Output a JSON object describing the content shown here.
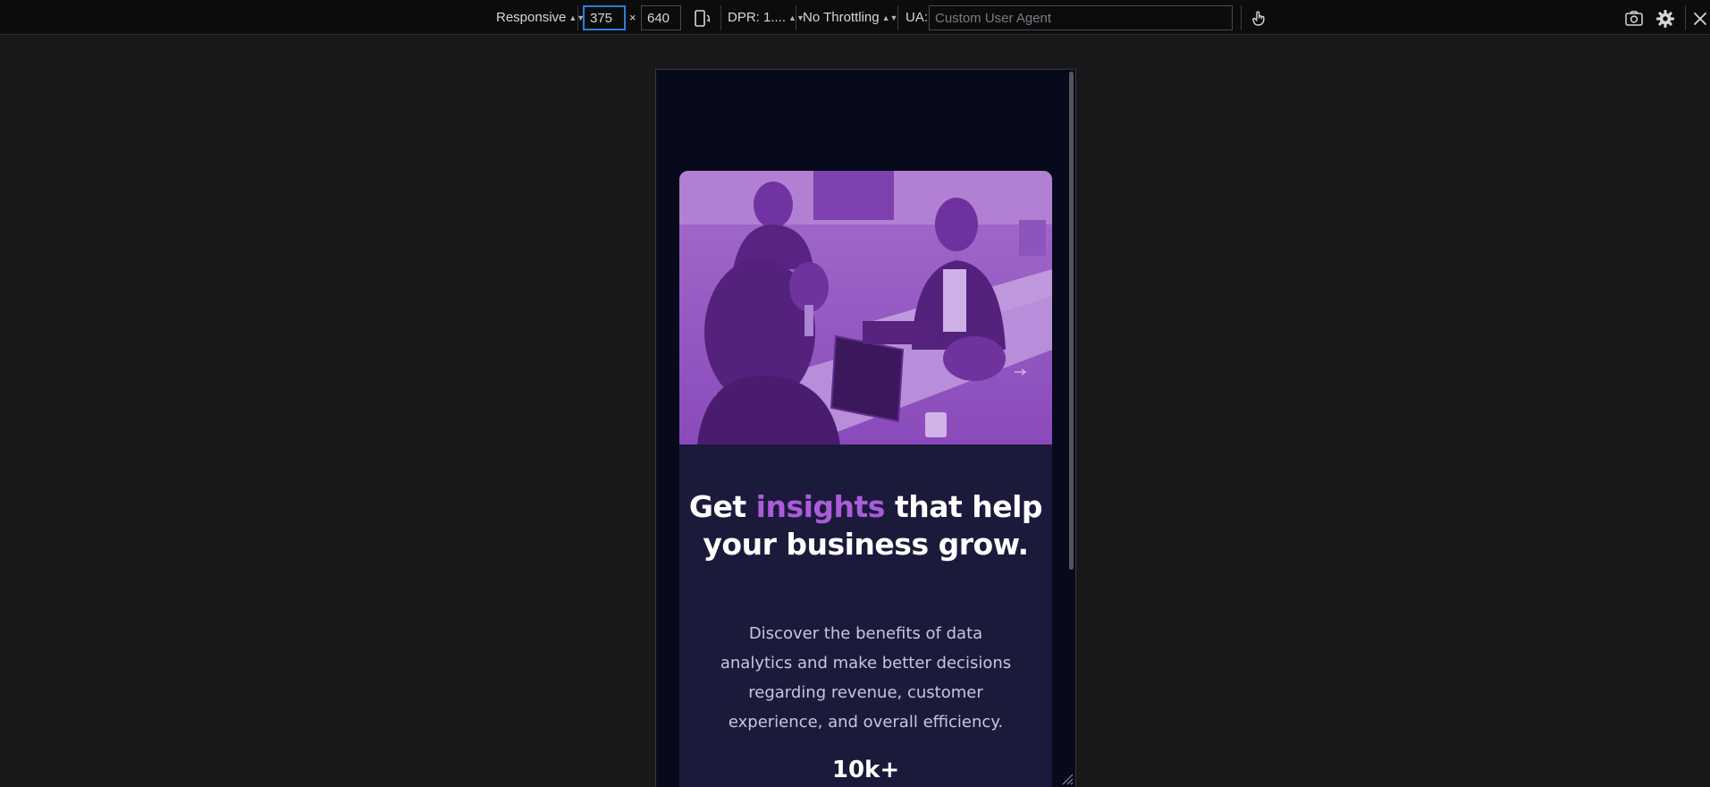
{
  "toolbar": {
    "device_select": "Responsive",
    "width_value": "375",
    "times_symbol": "×",
    "height_value": "640",
    "rotate_icon": "rotate-device-icon",
    "dpr_select": "DPR: 1....",
    "throttling_select": "No Throttling",
    "ua_label": "UA:",
    "ua_placeholder": "Custom User Agent",
    "touch_icon": "touch-simulation-icon",
    "screenshot_icon": "camera-icon",
    "settings_icon": "gear-icon",
    "close_icon": "close-icon"
  },
  "page": {
    "headline_before": "Get ",
    "headline_accent": "insights",
    "headline_after": " that help your business grow.",
    "description": "Discover the benefits of data analytics and make better decisions regarding revenue, customer experience, and overall efficiency.",
    "stat_value": "10k+"
  },
  "colors": {
    "page_bg": "#070a1a",
    "card_bg": "#1c1a3b",
    "accent": "#aa5cdb",
    "hero_tint": "#8d4bbf"
  }
}
